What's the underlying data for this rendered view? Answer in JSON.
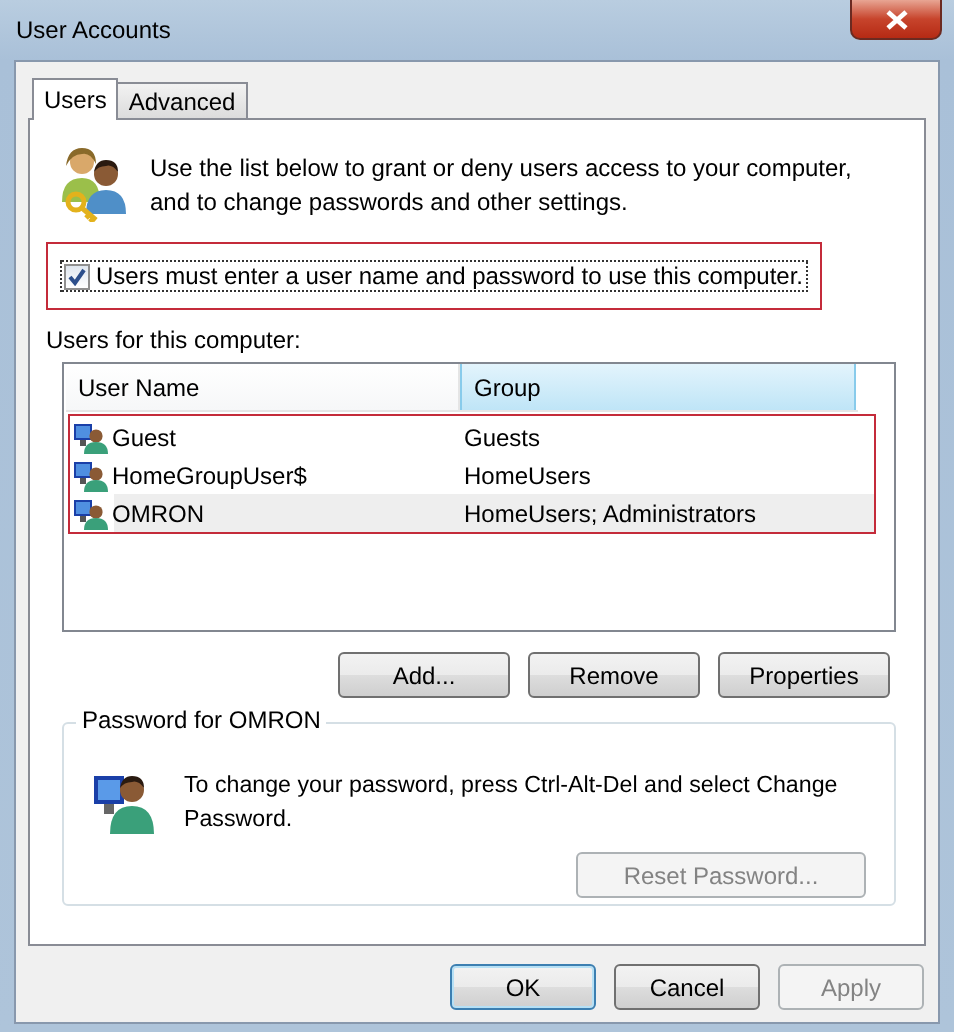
{
  "window": {
    "title": "User Accounts"
  },
  "tabs": [
    {
      "label": "Users",
      "selected": true
    },
    {
      "label": "Advanced",
      "selected": false
    }
  ],
  "intro": "Use the list below to grant or deny users access to your computer, and to change passwords and other settings.",
  "require_password": {
    "label": "Users must enter a user name and password to use this computer.",
    "checked": true
  },
  "users_label": "Users for this computer:",
  "table": {
    "columns": [
      {
        "label": "User Name",
        "highlighted": false
      },
      {
        "label": "Group",
        "highlighted": true
      }
    ],
    "rows": [
      {
        "name": "Guest",
        "group": "Guests",
        "selected": false
      },
      {
        "name": "HomeGroupUser$",
        "group": "HomeUsers",
        "selected": false
      },
      {
        "name": "OMRON",
        "group": "HomeUsers; Administrators",
        "selected": true
      }
    ]
  },
  "list_buttons": [
    {
      "label": "Add...",
      "disabled": false
    },
    {
      "label": "Remove",
      "disabled": false
    },
    {
      "label": "Properties",
      "disabled": false
    }
  ],
  "password_group": {
    "title": "Password for OMRON",
    "text": "To change your password, press Ctrl-Alt-Del and select Change Password.",
    "button": {
      "label": "Reset Password...",
      "disabled": true
    }
  },
  "dialog_buttons": [
    {
      "label": "OK",
      "default": true,
      "disabled": false
    },
    {
      "label": "Cancel",
      "default": false,
      "disabled": false
    },
    {
      "label": "Apply",
      "default": false,
      "disabled": true
    }
  ]
}
